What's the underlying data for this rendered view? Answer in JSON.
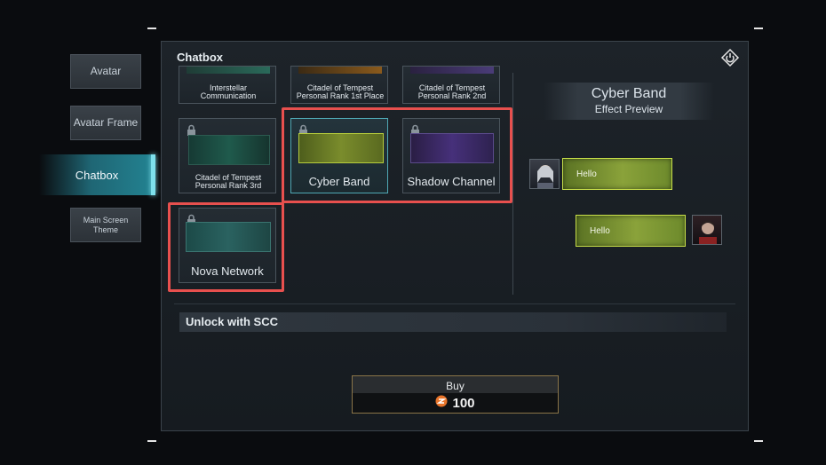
{
  "sidebar": {
    "items": [
      {
        "label": "Avatar"
      },
      {
        "label": "Avatar Frame"
      },
      {
        "label": "Chatbox"
      },
      {
        "label": "Main Screen Theme"
      }
    ]
  },
  "panel": {
    "title": "Chatbox"
  },
  "items": [
    {
      "label": "Interstellar Communication"
    },
    {
      "label": "Citadel of Tempest Personal Rank 1st Place"
    },
    {
      "label": "Citadel of Tempest Personal Rank 2nd"
    },
    {
      "label": "Citadel of Tempest Personal Rank 3rd"
    },
    {
      "label": "Cyber Band"
    },
    {
      "label": "Shadow Channel"
    },
    {
      "label": "Nova Network"
    }
  ],
  "preview": {
    "name": "Cyber Band",
    "subtitle": "Effect Preview",
    "messages": [
      {
        "text": "Hello"
      },
      {
        "text": "Hello"
      }
    ],
    "bubble_color": "#8aa23a"
  },
  "unlock": {
    "label": "Unlock with SCC"
  },
  "buy": {
    "label": "Buy",
    "price": "100",
    "currency_icon": "scc-coin-icon"
  },
  "colors": {
    "highlight": "#e8504e",
    "active_tab": "#238392",
    "accent": "#7ee0ec"
  }
}
